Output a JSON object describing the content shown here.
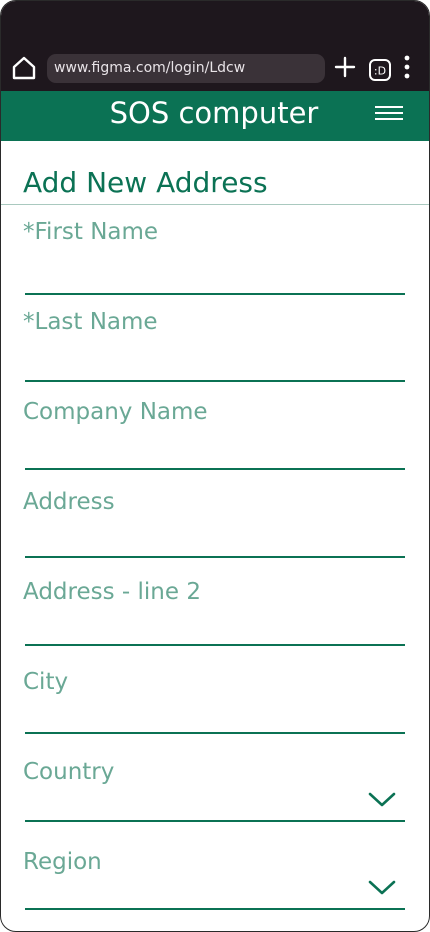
{
  "browser": {
    "url": "www.figma.com/login/Ldcw",
    "home_icon": "home-icon",
    "new_tab_icon": "plus-icon",
    "tabs_icon": "tab-switcher-icon",
    "menu_icon": "kebab-menu-icon"
  },
  "header": {
    "title": "SOS computer",
    "menu_icon": "hamburger-icon",
    "background": "#0b7254"
  },
  "page": {
    "title": "Add New Address"
  },
  "form": {
    "fields": [
      {
        "label": "*First Name",
        "value": "",
        "type": "text"
      },
      {
        "label": "*Last  Name",
        "value": "",
        "type": "text"
      },
      {
        "label": "Company Name",
        "value": "",
        "type": "text"
      },
      {
        "label": "Address",
        "value": "",
        "type": "text"
      },
      {
        "label": "Address - line 2",
        "value": "",
        "type": "text"
      },
      {
        "label": "City",
        "value": "",
        "type": "text"
      },
      {
        "label": "Country",
        "value": "",
        "type": "select",
        "icon": "chevron-down-icon"
      },
      {
        "label": "Region",
        "value": "",
        "type": "select",
        "icon": "chevron-down-icon"
      }
    ]
  },
  "colors": {
    "accent": "#0b7254",
    "label": "#6aa895",
    "browser_bg": "#1e171d",
    "url_bg": "#3a3238"
  }
}
